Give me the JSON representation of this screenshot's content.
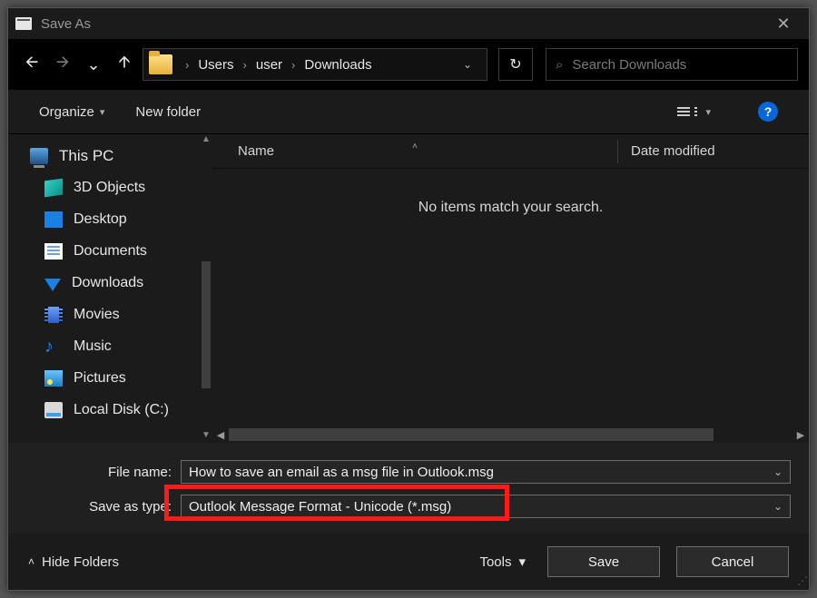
{
  "title": "Save As",
  "nav": {
    "crumbs": [
      "Users",
      "user",
      "Downloads"
    ],
    "search_placeholder": "Search Downloads"
  },
  "toolbar": {
    "organize": "Organize",
    "new_folder": "New folder"
  },
  "tree": {
    "root": "This PC",
    "items": [
      "3D Objects",
      "Desktop",
      "Documents",
      "Downloads",
      "Movies",
      "Music",
      "Pictures",
      "Local Disk (C:)"
    ]
  },
  "columns": {
    "name": "Name",
    "date": "Date modified"
  },
  "empty_message": "No items match your search.",
  "form": {
    "file_name_label": "File name:",
    "file_name_value": "How to save an email as a msg file in Outlook.msg",
    "save_type_label": "Save as type:",
    "save_type_value": "Outlook Message Format - Unicode (*.msg)"
  },
  "footer": {
    "hide_folders": "Hide Folders",
    "tools": "Tools",
    "save": "Save",
    "cancel": "Cancel"
  },
  "help_glyph": "?"
}
